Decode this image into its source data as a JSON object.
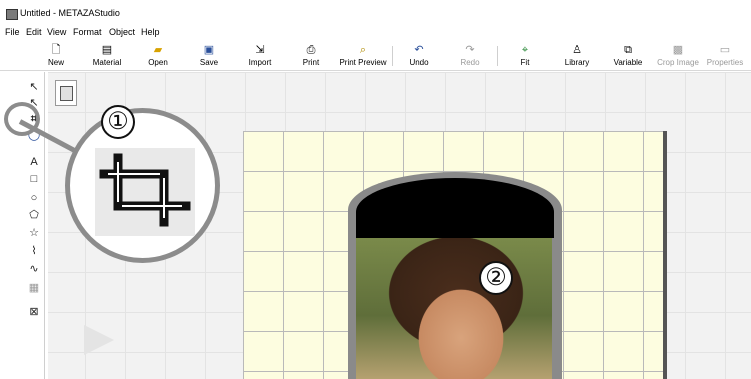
{
  "window": {
    "title": "Untitled - METAZAStudio"
  },
  "menu": [
    "File",
    "Edit",
    "View",
    "Format",
    "Object",
    "Help"
  ],
  "toolbar": {
    "buttons": [
      {
        "label": "New",
        "icon": "new-document-icon",
        "disabled": false
      },
      {
        "label": "Material",
        "icon": "material-icon",
        "disabled": false
      },
      {
        "label": "Open",
        "icon": "folder-open-icon",
        "disabled": false
      },
      {
        "label": "Save",
        "icon": "floppy-disk-icon",
        "disabled": false
      },
      {
        "label": "Import",
        "icon": "import-icon",
        "disabled": false
      },
      {
        "label": "Print",
        "icon": "printer-icon",
        "disabled": false
      },
      {
        "label": "Print Preview",
        "icon": "print-preview-icon",
        "disabled": false
      },
      {
        "label": "Undo",
        "icon": "undo-icon",
        "disabled": false
      },
      {
        "label": "Redo",
        "icon": "redo-icon",
        "disabled": true
      },
      {
        "label": "Fit",
        "icon": "fit-icon",
        "disabled": false
      },
      {
        "label": "Library",
        "icon": "library-icon",
        "disabled": false
      },
      {
        "label": "Variable",
        "icon": "variable-icon",
        "disabled": false
      },
      {
        "label": "Crop Image",
        "icon": "crop-image-icon",
        "disabled": true
      },
      {
        "label": "Properties",
        "icon": "properties-icon",
        "disabled": true
      }
    ]
  },
  "tools": [
    {
      "name": "select-tool",
      "icon": "arrow-pointer-icon",
      "glyph": "↖"
    },
    {
      "name": "node-edit-tool",
      "icon": "node-edit-icon",
      "glyph": "↖"
    },
    {
      "name": "crop-tool",
      "icon": "crop-icon",
      "glyph": "⌗"
    },
    {
      "name": "zoom-tool",
      "icon": "zoom-icon",
      "glyph": "◯"
    },
    {
      "name": "text-tool",
      "icon": "text-icon",
      "glyph": "A"
    },
    {
      "name": "rectangle-tool",
      "icon": "rectangle-icon",
      "glyph": "□"
    },
    {
      "name": "ellipse-tool",
      "icon": "ellipse-icon",
      "glyph": "○"
    },
    {
      "name": "polygon-tool",
      "icon": "pentagon-icon",
      "glyph": "⬠"
    },
    {
      "name": "star-tool",
      "icon": "star-icon",
      "glyph": "☆"
    },
    {
      "name": "polyline-tool",
      "icon": "polyline-icon",
      "glyph": "⌇"
    },
    {
      "name": "curve-tool",
      "icon": "curve-icon",
      "glyph": "∿"
    },
    {
      "name": "image-tool",
      "icon": "image-placeholder-icon",
      "glyph": "▦"
    },
    {
      "name": "delete-image-tool",
      "icon": "image-frame-x-icon",
      "glyph": "⊠"
    }
  ],
  "callouts": {
    "one": "①",
    "two": "②"
  },
  "colors": {
    "page": "#fdfde0",
    "grid": "#b9b9b9",
    "frame": "#8a8a8a",
    "callout_ring": "#8c8c8c"
  }
}
